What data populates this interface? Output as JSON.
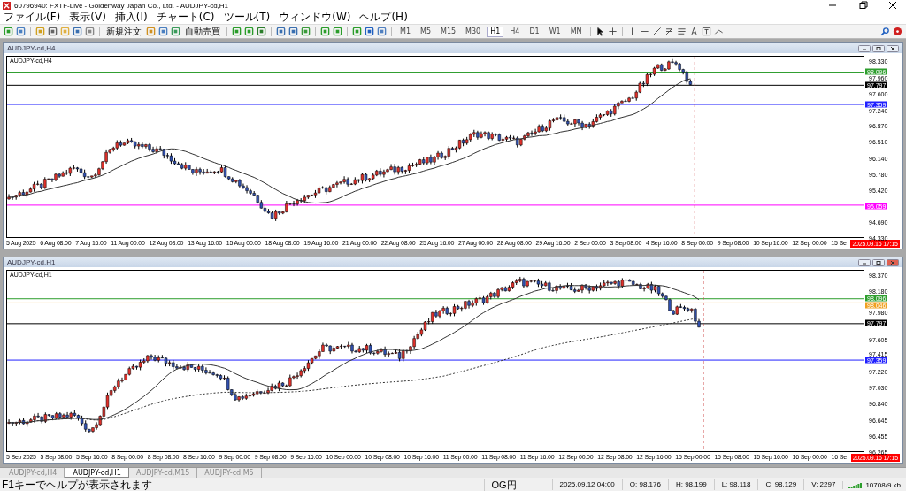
{
  "window": {
    "title": "60796940: FXTF-Live - Goldenway Japan Co., Ltd. - AUDJPY-cd,H1"
  },
  "menu": [
    "ファイル(F)",
    "表示(V)",
    "挿入(I)",
    "チャート(C)",
    "ツール(T)",
    "ウィンドウ(W)",
    "ヘルプ(H)"
  ],
  "toolbar": {
    "new_order": "新規注文",
    "auto_trading": "自動売買",
    "timeframes": [
      {
        "label": "M1",
        "selected": false
      },
      {
        "label": "M5",
        "selected": false
      },
      {
        "label": "M15",
        "selected": false
      },
      {
        "label": "M30",
        "selected": false
      },
      {
        "label": "H1",
        "selected": true
      },
      {
        "label": "H4",
        "selected": false
      },
      {
        "label": "D1",
        "selected": false
      },
      {
        "label": "W1",
        "selected": false
      },
      {
        "label": "MN",
        "selected": false
      }
    ]
  },
  "charts": [
    {
      "kind": "h4",
      "title": "AUDJPY-cd,H4",
      "symbol": "AUDJPY-cd,H4",
      "prices": [
        "98.330",
        "97.960",
        "97.600",
        "97.240",
        "96.870",
        "96.510",
        "96.140",
        "95.780",
        "95.420",
        "94.690",
        "94.330"
      ],
      "levels": [
        {
          "label": "98.096",
          "color": "#2e9e2e"
        },
        {
          "label": "97.797",
          "color": "#000000"
        },
        {
          "label": "97.359",
          "color": "#2020ff"
        },
        {
          "label": "95.059",
          "color": "#ff00ff"
        }
      ],
      "times": [
        "5 Aug 2025",
        "6 Aug 08:00",
        "7 Aug 16:00",
        "11 Aug 00:00",
        "12 Aug 08:00",
        "13 Aug 16:00",
        "15 Aug 00:00",
        "18 Aug 08:00",
        "19 Aug 16:00",
        "21 Aug 00:00",
        "22 Aug 08:00",
        "25 Aug 16:00",
        "27 Aug 00:00",
        "28 Aug 08:00",
        "29 Aug 16:00",
        "2 Sep 00:00",
        "3 Sep 08:00",
        "4 Sep 16:00",
        "8 Sep 00:00",
        "9 Sep 08:00",
        "10 Sep 16:00",
        "12 Sep 00:00",
        "15 Se"
      ],
      "cursor_time": "2025.09.16 17:15"
    },
    {
      "kind": "h1",
      "title": "AUDJPY-cd,H1",
      "symbol": "AUDJPY-cd,H1",
      "prices": [
        "98.370",
        "98.180",
        "97.980",
        "97.605",
        "97.415",
        "97.220",
        "97.030",
        "96.840",
        "96.645",
        "96.455",
        "96.265"
      ],
      "levels": [
        {
          "label": "98.096",
          "color": "#2e9e2e"
        },
        {
          "label": "98.046",
          "color": "#f0a020"
        },
        {
          "label": "97.797",
          "color": "#000000"
        },
        {
          "label": "97.359",
          "color": "#2020ff"
        }
      ],
      "times": [
        "5 Sep 2025",
        "5 Sep 08:00",
        "5 Sep 16:00",
        "8 Sep 00:00",
        "8 Sep 08:00",
        "8 Sep 16:00",
        "9 Sep 00:00",
        "9 Sep 08:00",
        "9 Sep 16:00",
        "10 Sep 00:00",
        "10 Sep 08:00",
        "10 Sep 16:00",
        "11 Sep 00:00",
        "11 Sep 08:00",
        "11 Sep 16:00",
        "12 Sep 00:00",
        "12 Sep 08:00",
        "12 Sep 16:00",
        "15 Sep 00:00",
        "15 Sep 08:00",
        "15 Sep 16:00",
        "16 Sep 00:00",
        "16 Se"
      ],
      "cursor_time": "2025.09.16 17:15"
    }
  ],
  "tabs": [
    {
      "label": "AUDJPY-cd,H4",
      "selected": false
    },
    {
      "label": "AUDJPY-cd,H1",
      "selected": true
    },
    {
      "label": "AUDJPY-cd,M15",
      "selected": false
    },
    {
      "label": "AUDJPY-cd,M5",
      "selected": false
    }
  ],
  "status_bar": {
    "help": "F1キーでヘルプが表示されます",
    "profile": "OG円",
    "time": "2025.09.12 04:00",
    "open": "O: 98.176",
    "high": "H: 98.199",
    "low": "L: 98.118",
    "close": "C: 98.129",
    "volume": "V: 2297",
    "traffic": "10708/9 kb"
  }
}
